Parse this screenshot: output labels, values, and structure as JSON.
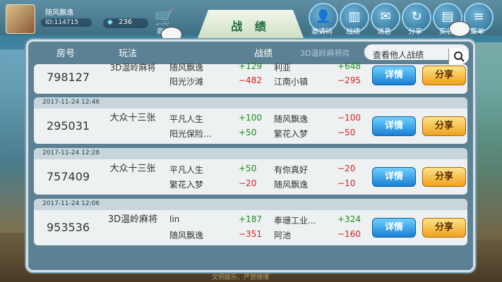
{
  "user": {
    "name": "随风飘逸",
    "id": "ID:114715",
    "gems": "236"
  },
  "shop_label": "商城",
  "title": "战 绩",
  "top_buttons": [
    {
      "label": "邀请码",
      "icon": "user-icon"
    },
    {
      "label": "战绩",
      "icon": "chart-icon"
    },
    {
      "label": "消息",
      "icon": "mail-icon"
    },
    {
      "label": "分享",
      "icon": "share-icon"
    },
    {
      "label": "实名",
      "icon": "id-card-icon"
    },
    {
      "label": "菜单",
      "icon": "menu-icon"
    }
  ],
  "header": {
    "col_room": "房号",
    "col_game": "玩法",
    "col_record": "战绩",
    "scroll": "3D温岭麻将欢",
    "search_text": "查看他人战绩"
  },
  "records": [
    {
      "date": "",
      "room": "798127",
      "game": "3D温岭麻将",
      "left": [
        {
          "name": "随风飘逸",
          "score": "+129"
        },
        {
          "name": "阳光沙滩",
          "score": "−482"
        }
      ],
      "right": [
        {
          "name": "利亚",
          "score": "+648"
        },
        {
          "name": "江南小镇",
          "score": "−295"
        }
      ]
    },
    {
      "date": "2017-11-24 12:46",
      "room": "295031",
      "game": "大众十三张",
      "left": [
        {
          "name": "平凡人生",
          "score": "+100"
        },
        {
          "name": "阳光保险...",
          "score": "+50"
        }
      ],
      "right": [
        {
          "name": "随风飘逸",
          "score": "−100"
        },
        {
          "name": "繁花入梦",
          "score": "−50"
        }
      ]
    },
    {
      "date": "2017-11-24 12:28",
      "room": "757409",
      "game": "大众十三张",
      "left": [
        {
          "name": "平凡人生",
          "score": "+50"
        },
        {
          "name": "繁花入梦",
          "score": "−20"
        }
      ],
      "right": [
        {
          "name": "有你真好",
          "score": "−20"
        },
        {
          "name": "随风飘逸",
          "score": "−10"
        }
      ]
    },
    {
      "date": "2017-11-24 12:06",
      "room": "953536",
      "game": "3D温岭麻将",
      "left": [
        {
          "name": "lin",
          "score": "+187"
        },
        {
          "name": "随风飘逸",
          "score": "−351"
        }
      ],
      "right": [
        {
          "name": "奉珊工业...",
          "score": "+324"
        },
        {
          "name": "阿池",
          "score": "−160"
        }
      ]
    }
  ],
  "buttons": {
    "detail": "详情",
    "share": "分享"
  },
  "bottom_text": "文明娱乐，严禁赌博",
  "colors": {
    "positive": "#1b8a1f",
    "negative": "#d82121",
    "detail_btn": "#1a7fd6",
    "share_btn": "#f0a11d"
  }
}
